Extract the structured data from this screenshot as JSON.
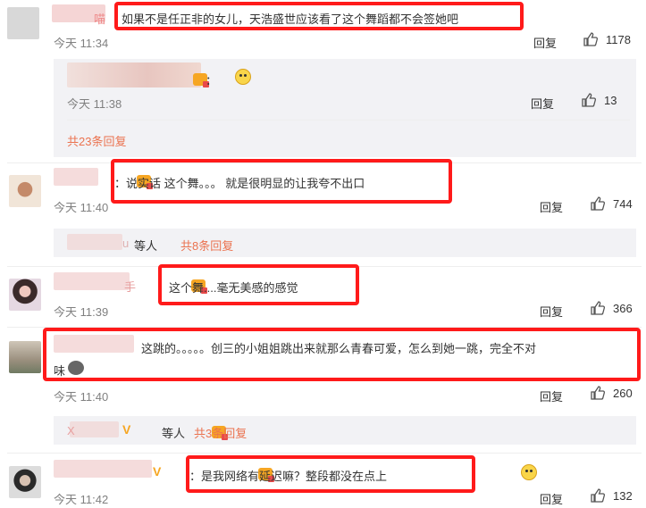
{
  "comments": [
    {
      "username_fragment": "喵",
      "text": "如果不是任正非的女儿，天浩盛世应该看了这个舞蹈都不会签她吧",
      "time": "今天 11:34",
      "reply_label": "回复",
      "likes": "1178"
    },
    {
      "time": "今天 11:38",
      "reply_label": "回复",
      "likes": "13",
      "colon": "："
    },
    {
      "total_replies": "共23条回复"
    },
    {
      "text": "：说实话 这个舞。。。  就是很明显的让我夸不出口",
      "time": "今天 11:40",
      "reply_label": "回复",
      "likes": "744"
    },
    {
      "username_fragment": "u",
      "others": "等人",
      "total_replies": "共8条回复"
    },
    {
      "username_fragment": "手",
      "text": "这个舞....毫无美感的感觉",
      "time": "今天 11:39",
      "reply_label": "回复",
      "likes": "366"
    },
    {
      "text_line1": "这跳的。。。。。创三的小姐姐跳出来就那么青春可爱，怎么到她一跳，完全不对",
      "text_line2": "味",
      "time": "今天 11:40",
      "reply_label": "回复",
      "likes": "260"
    },
    {
      "username_fragment": "X",
      "others": "等人",
      "total_replies": "共3条回复"
    },
    {
      "text": "：是我网络有延迟嘛？整段都没在点上",
      "time": "今天 11:42",
      "reply_label": "回复",
      "likes": "132"
    }
  ],
  "icons": {
    "like": "thumbs-up-icon",
    "emoji": "smiley-emoji-icon",
    "badge": "member-badge-icon",
    "vip": "v-badge-icon"
  },
  "colors": {
    "highlight": "#ff1a1a",
    "link": "#eb7350",
    "muted": "#808080",
    "subpanel": "#f2f2f5"
  }
}
